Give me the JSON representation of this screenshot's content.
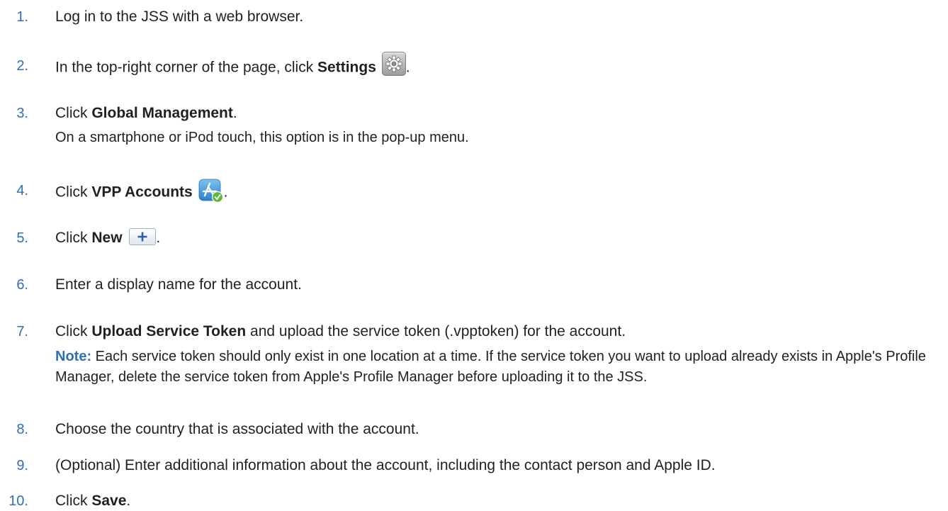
{
  "steps": [
    {
      "num": "1.",
      "parts": [
        {
          "t": "Log in to the JSS with a web browser."
        }
      ]
    },
    {
      "num": "2.",
      "parts": [
        {
          "t": "In the top-right corner of the page, click "
        },
        {
          "b": "Settings"
        }
      ],
      "icon": "gear-icon",
      "after": "."
    },
    {
      "num": "3.",
      "parts": [
        {
          "t": "Click "
        },
        {
          "b": "Global Management"
        },
        {
          "t": "."
        }
      ],
      "sub": "On a smartphone or iPod touch, this option is in the pop-up menu."
    },
    {
      "num": "4.",
      "parts": [
        {
          "t": "Click "
        },
        {
          "b": "VPP Accounts"
        }
      ],
      "icon": "app-store-icon",
      "after": "."
    },
    {
      "num": "5.",
      "parts": [
        {
          "t": "Click "
        },
        {
          "b": "New"
        }
      ],
      "icon": "plus-icon",
      "after": "."
    },
    {
      "num": "6.",
      "parts": [
        {
          "t": "Enter a display name for the account."
        }
      ]
    },
    {
      "num": "7.",
      "parts": [
        {
          "t": "Click "
        },
        {
          "b": "Upload Service Token"
        },
        {
          "t": " and upload the service token (.vpptoken) for the account."
        }
      ],
      "note_label": "Note:",
      "note_text": " Each service token should only exist in one location at a time. If the service token you want to upload already exists in Apple's Profile Manager, delete the service token from Apple's Profile Manager before uploading it to the JSS."
    },
    {
      "num": "8.",
      "parts": [
        {
          "t": "Choose the country that is associated with the account."
        }
      ]
    },
    {
      "num": "9.",
      "parts": [
        {
          "t": "(Optional) Enter additional information about the account, including the contact person and Apple ID."
        }
      ]
    },
    {
      "num": "10.",
      "parts": [
        {
          "t": "Click "
        },
        {
          "b": "Save"
        },
        {
          "t": "."
        }
      ]
    }
  ],
  "colors": {
    "number": "#2f6fb4",
    "note_label": "#2f6fb4",
    "body_text": "#231f20"
  }
}
